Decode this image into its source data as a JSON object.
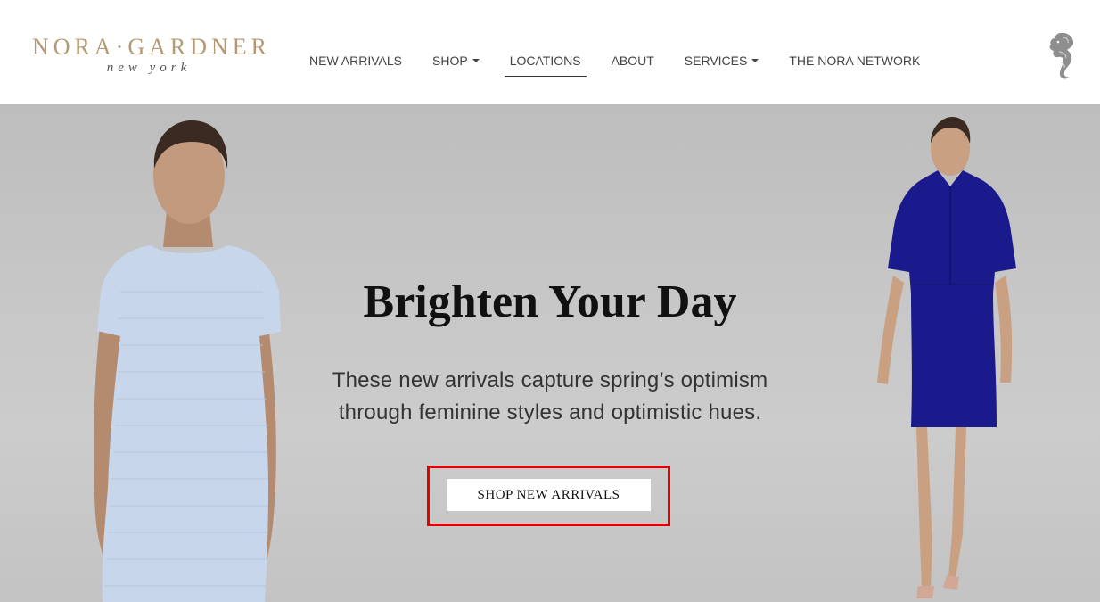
{
  "header": {
    "logo": {
      "brand": "NORA·GARDNER",
      "sub": "new york"
    },
    "nav": [
      {
        "label": "NEW ARRIVALS",
        "has_dropdown": false,
        "active": false
      },
      {
        "label": "SHOP",
        "has_dropdown": true,
        "active": false
      },
      {
        "label": "LOCATIONS",
        "has_dropdown": false,
        "active": true
      },
      {
        "label": "ABOUT",
        "has_dropdown": false,
        "active": false
      },
      {
        "label": "SERVICES",
        "has_dropdown": true,
        "active": false
      },
      {
        "label": "THE NORA NETWORK",
        "has_dropdown": false,
        "active": false
      }
    ],
    "brand_icon": "seahorse-icon"
  },
  "hero": {
    "headline": "Brighten Your Day",
    "subtext_line1": "These new arrivals capture spring’s optimism",
    "subtext_line2": "through feminine styles and optimistic hues.",
    "cta_label": "SHOP NEW ARRIVALS"
  },
  "colors": {
    "logo_gold": "#b49a74",
    "highlight_red": "#e30000",
    "dress_left": "#c7d6ea",
    "dress_right": "#1a1a8c",
    "hero_bg": "#c6c6c6"
  }
}
